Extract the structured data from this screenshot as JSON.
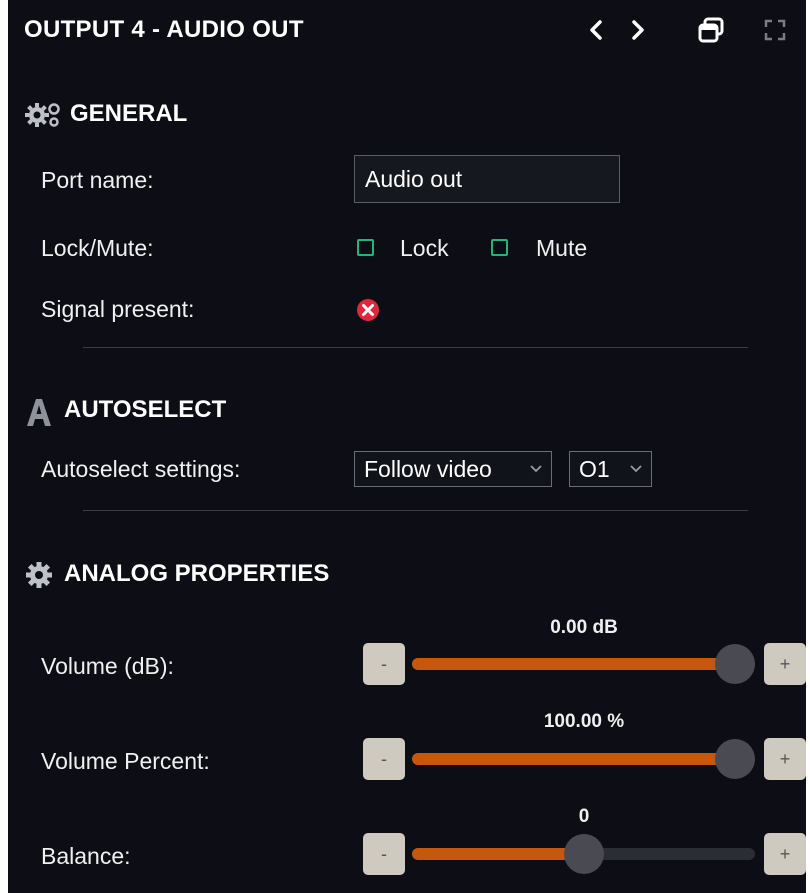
{
  "window": {
    "title": "OUTPUT 4 - AUDIO OUT"
  },
  "icons": {
    "prev": "chevron-left-icon",
    "next": "chevron-right-icon",
    "restore": "window-restore-icon",
    "fullscreen": "fullscreen-icon",
    "general": "gears-icon",
    "autoselect": "letter-a-icon",
    "analog": "gear-icon",
    "signal": "error-circle-icon"
  },
  "colors": {
    "accent": "#c5580d",
    "checkbox": "#22b57a",
    "error": "#e0283c",
    "background": "#0c0d15"
  },
  "general": {
    "heading": "GENERAL",
    "port_name_label": "Port name:",
    "port_name_value": "Audio out",
    "lock_mute_label": "Lock/Mute:",
    "lock_label": "Lock",
    "lock_checked": false,
    "mute_label": "Mute",
    "mute_checked": false,
    "signal_label": "Signal present:",
    "signal_present": false
  },
  "autoselect": {
    "heading": "AUTOSELECT",
    "settings_label": "Autoselect settings:",
    "mode_value": "Follow video",
    "output_value": "O1"
  },
  "analog": {
    "heading": "ANALOG PROPERTIES",
    "volume_db": {
      "label": "Volume (dB):",
      "value_text": "0.00 dB",
      "level": 1.0,
      "minus": "-",
      "plus": "+"
    },
    "volume_percent": {
      "label": "Volume Percent:",
      "value_text": "100.00 %",
      "level": 1.0,
      "minus": "-",
      "plus": "+"
    },
    "balance": {
      "label": "Balance:",
      "value_text": "0",
      "level": 0.5,
      "minus": "-",
      "plus": "+"
    }
  }
}
